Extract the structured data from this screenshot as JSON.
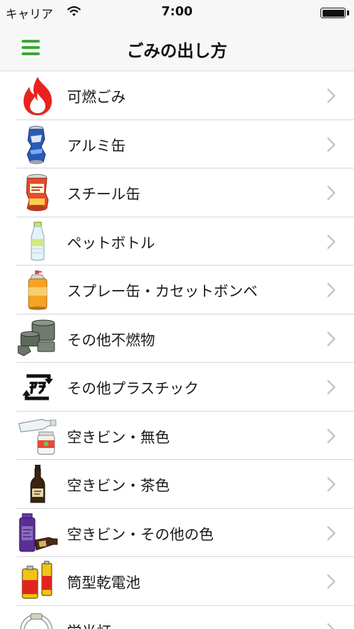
{
  "status": {
    "carrier": "キャリア",
    "time": "7:00"
  },
  "nav": {
    "title": "ごみの出し方"
  },
  "items": [
    {
      "label": "可燃ごみ",
      "icon": "flame-icon"
    },
    {
      "label": "アルミ缶",
      "icon": "aluminum-can-icon"
    },
    {
      "label": "スチール缶",
      "icon": "steel-can-icon"
    },
    {
      "label": "ペットボトル",
      "icon": "pet-bottle-icon"
    },
    {
      "label": "スプレー缶・カセットボンベ",
      "icon": "spray-can-icon"
    },
    {
      "label": "その他不燃物",
      "icon": "cookware-icon"
    },
    {
      "label": "その他プラスチック",
      "icon": "plastic-recycle-mark-icon"
    },
    {
      "label": "空きビン・無色",
      "icon": "clear-bottle-icon"
    },
    {
      "label": "空きビン・茶色",
      "icon": "brown-bottle-icon"
    },
    {
      "label": "空きビン・その他の色",
      "icon": "colored-bottle-icon"
    },
    {
      "label": "筒型乾電池",
      "icon": "battery-icon"
    },
    {
      "label": "蛍光灯",
      "icon": "fluorescent-lamp-icon"
    }
  ],
  "colors": {
    "accent": "#3aa637",
    "chevron": "#c4c4c9",
    "flame": "#e8231e"
  }
}
